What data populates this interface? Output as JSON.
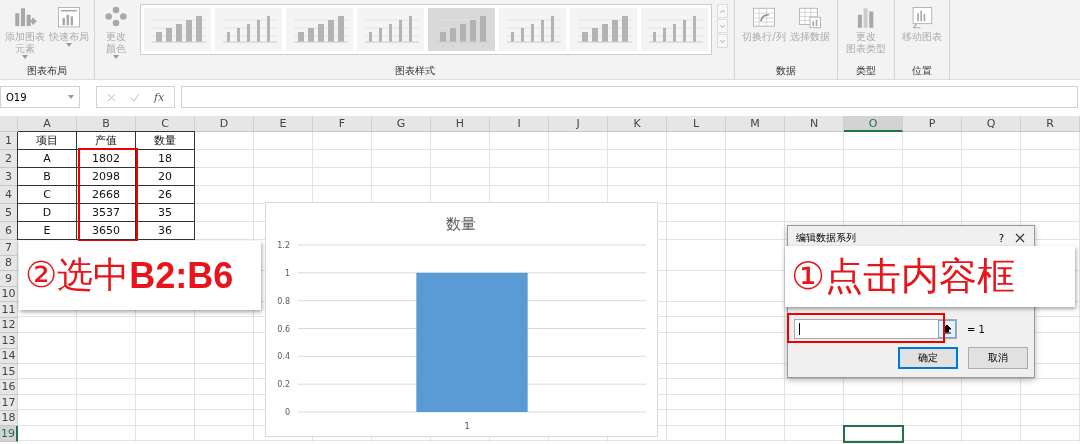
{
  "ribbon": {
    "groups": [
      {
        "label": "图表布局",
        "buttons": [
          {
            "lines": [
              "添加图表",
              "元素"
            ],
            "dropdown": true,
            "disabled": true
          },
          {
            "lines": [
              "快速布局"
            ],
            "dropdown": true,
            "disabled": true
          }
        ]
      },
      {
        "label": "图表样式",
        "buttons": [
          {
            "lines": [
              "更改",
              "颜色"
            ],
            "dropdown": true,
            "disabled": true
          }
        ],
        "styles": [
          {
            "selected": false
          },
          {
            "selected": false
          },
          {
            "selected": false
          },
          {
            "selected": false
          },
          {
            "selected": true
          },
          {
            "selected": false
          },
          {
            "selected": false
          },
          {
            "selected": false
          }
        ]
      },
      {
        "label": "数据",
        "buttons": [
          {
            "lines": [
              "切换行/列"
            ],
            "dropdown": false,
            "disabled": true
          },
          {
            "lines": [
              "选择数据"
            ],
            "dropdown": false,
            "disabled": true
          }
        ]
      },
      {
        "label": "类型",
        "buttons": [
          {
            "lines": [
              "更改",
              "图表类型"
            ],
            "dropdown": false,
            "disabled": true
          }
        ]
      },
      {
        "label": "位置",
        "buttons": [
          {
            "lines": [
              "移动图表"
            ],
            "dropdown": false,
            "disabled": true
          }
        ]
      }
    ]
  },
  "formula_bar": {
    "name_box": "O19",
    "function_label": "fx"
  },
  "sheet": {
    "columns": [
      {
        "label": "A",
        "selected": false
      },
      {
        "label": "B",
        "selected": false
      },
      {
        "label": "C",
        "selected": false
      },
      {
        "label": "D",
        "selected": false
      },
      {
        "label": "E",
        "selected": false
      },
      {
        "label": "F",
        "selected": false
      },
      {
        "label": "G",
        "selected": false
      },
      {
        "label": "H",
        "selected": false
      },
      {
        "label": "I",
        "selected": false
      },
      {
        "label": "J",
        "selected": false
      },
      {
        "label": "K",
        "selected": false
      },
      {
        "label": "L",
        "selected": false
      },
      {
        "label": "M",
        "selected": false
      },
      {
        "label": "N",
        "selected": false
      },
      {
        "label": "O",
        "selected": true
      },
      {
        "label": "P",
        "selected": false
      },
      {
        "label": "Q",
        "selected": false
      },
      {
        "label": "R",
        "selected": false
      }
    ],
    "rows": [
      {
        "label": "1",
        "selected": false
      },
      {
        "label": "2",
        "selected": false
      },
      {
        "label": "3",
        "selected": false
      },
      {
        "label": "4",
        "selected": false
      },
      {
        "label": "5",
        "selected": false
      },
      {
        "label": "6",
        "selected": false
      },
      {
        "label": "7",
        "selected": false
      },
      {
        "label": "8",
        "selected": false
      },
      {
        "label": "9",
        "selected": false
      },
      {
        "label": "10",
        "selected": false
      },
      {
        "label": "11",
        "selected": false
      },
      {
        "label": "12",
        "selected": false
      },
      {
        "label": "13",
        "selected": false
      },
      {
        "label": "14",
        "selected": false
      },
      {
        "label": "15",
        "selected": false
      },
      {
        "label": "16",
        "selected": false
      },
      {
        "label": "17",
        "selected": false
      },
      {
        "label": "18",
        "selected": false
      },
      {
        "label": "19",
        "selected": true
      }
    ],
    "cells": [
      [
        "项目",
        "产值",
        "数量"
      ],
      [
        "A",
        "1802",
        "18"
      ],
      [
        "B",
        "2098",
        "20"
      ],
      [
        "C",
        "2668",
        "26"
      ],
      [
        "D",
        "3537",
        "35"
      ],
      [
        "E",
        "3650",
        "36"
      ]
    ]
  },
  "chart": {
    "chart_data": {
      "type": "bar",
      "grid": true,
      "title": "数量",
      "categories": [
        "1"
      ],
      "values": [
        1
      ],
      "ylim": [
        0,
        1.2
      ],
      "yticks": [
        0,
        0.2,
        0.4,
        0.6,
        0.8,
        1,
        1.2
      ]
    }
  },
  "dialog": {
    "title": "编辑数据系列",
    "help": "?",
    "result": "= 1",
    "buttons": [
      {
        "label": "确定",
        "selected": true
      },
      {
        "label": "取消",
        "selected": false
      }
    ]
  },
  "callouts": [
    {
      "text": "②选中**B2:B6**"
    },
    {
      "text": "①点击内容框"
    }
  ]
}
